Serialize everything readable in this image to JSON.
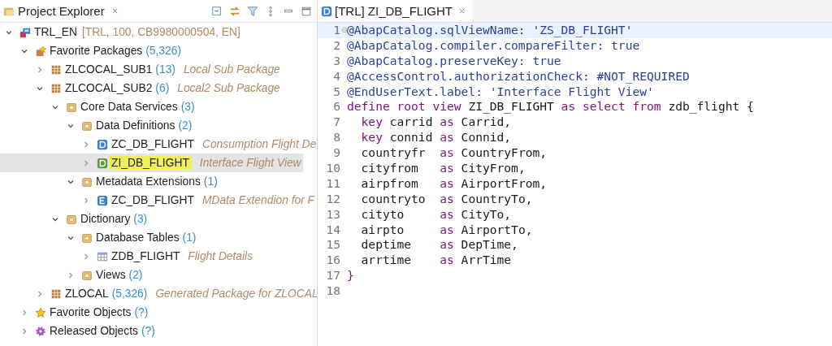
{
  "explorer": {
    "title": "Project Explorer",
    "tree": [
      {
        "name": "TRL_EN",
        "kind": "system",
        "info": "[TRL, 100, CB9980000504, EN]",
        "expanded": true,
        "selected": false,
        "children": [
          {
            "name": "Favorite Packages",
            "kind": "favorites",
            "count": "(5,326)",
            "expanded": true,
            "selected": false,
            "children": [
              {
                "name": "ZLCOCAL_SUB1",
                "kind": "package",
                "count": "(13)",
                "description": "Local Sub Package",
                "expanded": false,
                "selected": false
              },
              {
                "name": "ZLCOCAL_SUB2",
                "kind": "package",
                "count": "(6)",
                "description": "Local2 Sub Package",
                "expanded": true,
                "selected": false,
                "children": [
                  {
                    "name": "Core Data Services",
                    "kind": "folder",
                    "count": "(3)",
                    "expanded": true,
                    "selected": false,
                    "children": [
                      {
                        "name": "Data Definitions",
                        "kind": "folder",
                        "count": "(2)",
                        "expanded": true,
                        "selected": false,
                        "children": [
                          {
                            "name": "ZC_DB_FLIGHT",
                            "kind": "ddl",
                            "description": "Consumption Flight De",
                            "expanded": false,
                            "selected": false
                          },
                          {
                            "name": "ZI_DB_FLIGHT",
                            "kind": "ddl",
                            "description": "Interface Flight View",
                            "expanded": false,
                            "selected": true
                          }
                        ]
                      },
                      {
                        "name": "Metadata Extensions",
                        "kind": "folder",
                        "count": "(1)",
                        "expanded": true,
                        "selected": false,
                        "children": [
                          {
                            "name": "ZC_DB_FLIGHT",
                            "kind": "ddlx",
                            "description": "MData Extendion for F",
                            "expanded": false,
                            "selected": false
                          }
                        ]
                      }
                    ]
                  },
                  {
                    "name": "Dictionary",
                    "kind": "folder",
                    "count": "(3)",
                    "expanded": true,
                    "selected": false,
                    "children": [
                      {
                        "name": "Database Tables",
                        "kind": "folder",
                        "count": "(1)",
                        "expanded": true,
                        "selected": false,
                        "children": [
                          {
                            "name": "ZDB_FLIGHT",
                            "kind": "table",
                            "description": "Flight Details",
                            "expanded": false,
                            "selected": false
                          }
                        ]
                      },
                      {
                        "name": "Views",
                        "kind": "folder",
                        "count": "(2)",
                        "expanded": false,
                        "selected": false
                      }
                    ]
                  }
                ]
              },
              {
                "name": "ZLOCAL",
                "kind": "package",
                "count": "(5,326)",
                "description": "Generated Package for ZLOCAL",
                "expanded": false,
                "selected": false
              }
            ]
          },
          {
            "name": "Favorite Objects",
            "kind": "star",
            "count": "(?)",
            "expanded": false,
            "selected": false
          },
          {
            "name": "Released Objects",
            "kind": "gear",
            "count": "(?)",
            "expanded": false,
            "selected": false
          }
        ]
      }
    ]
  },
  "editor": {
    "tab": "[TRL] ZI_DB_FLIGHT",
    "lines": [
      {
        "n": "1",
        "current": true,
        "fold": true,
        "tokens": [
          {
            "kind": "ann",
            "text": "@AbapCatalog.sqlViewName: 'ZS_DB_FLIGHT'"
          }
        ]
      },
      {
        "n": "2",
        "current": false,
        "fold": false,
        "tokens": [
          {
            "kind": "ann",
            "text": "@AbapCatalog.compiler.compareFilter: true"
          }
        ]
      },
      {
        "n": "3",
        "current": false,
        "fold": false,
        "tokens": [
          {
            "kind": "ann",
            "text": "@AbapCatalog.preserveKey: true"
          }
        ]
      },
      {
        "n": "4",
        "current": false,
        "fold": false,
        "tokens": [
          {
            "kind": "ann",
            "text": "@AccessControl.authorizationCheck: #NOT_REQUIRED"
          }
        ]
      },
      {
        "n": "5",
        "current": false,
        "fold": false,
        "tokens": [
          {
            "kind": "ann",
            "text": "@EndUserText.label: 'Interface Flight View'"
          }
        ]
      },
      {
        "n": "6",
        "current": false,
        "fold": false,
        "tokens": [
          {
            "kind": "kw",
            "text": "define root view "
          },
          {
            "kind": "plain",
            "text": "ZI_DB_FLIGHT "
          },
          {
            "kind": "kw",
            "text": "as select from "
          },
          {
            "kind": "plain",
            "text": "zdb_flight {"
          }
        ]
      },
      {
        "n": "7",
        "current": false,
        "fold": false,
        "tokens": [
          {
            "kind": "kw",
            "text": "  key "
          },
          {
            "kind": "plain",
            "text": "carrid "
          },
          {
            "kind": "kw",
            "text": "as "
          },
          {
            "kind": "plain",
            "text": "Carrid,"
          }
        ]
      },
      {
        "n": "8",
        "current": false,
        "fold": false,
        "tokens": [
          {
            "kind": "kw",
            "text": "  key "
          },
          {
            "kind": "plain",
            "text": "connid "
          },
          {
            "kind": "kw",
            "text": "as "
          },
          {
            "kind": "plain",
            "text": "Connid,"
          }
        ]
      },
      {
        "n": "9",
        "current": false,
        "fold": false,
        "tokens": [
          {
            "kind": "plain",
            "text": "  countryfr  "
          },
          {
            "kind": "kw",
            "text": "as "
          },
          {
            "kind": "plain",
            "text": "CountryFrom,"
          }
        ]
      },
      {
        "n": "10",
        "current": false,
        "fold": false,
        "tokens": [
          {
            "kind": "plain",
            "text": "  cityfrom   "
          },
          {
            "kind": "kw",
            "text": "as "
          },
          {
            "kind": "plain",
            "text": "CityFrom,"
          }
        ]
      },
      {
        "n": "11",
        "current": false,
        "fold": false,
        "tokens": [
          {
            "kind": "plain",
            "text": "  airpfrom   "
          },
          {
            "kind": "kw",
            "text": "as "
          },
          {
            "kind": "plain",
            "text": "AirportFrom,"
          }
        ]
      },
      {
        "n": "12",
        "current": false,
        "fold": false,
        "tokens": [
          {
            "kind": "plain",
            "text": "  countryto  "
          },
          {
            "kind": "kw",
            "text": "as "
          },
          {
            "kind": "plain",
            "text": "CountryTo,"
          }
        ]
      },
      {
        "n": "13",
        "current": false,
        "fold": false,
        "tokens": [
          {
            "kind": "plain",
            "text": "  cityto     "
          },
          {
            "kind": "kw",
            "text": "as "
          },
          {
            "kind": "plain",
            "text": "CityTo,"
          }
        ]
      },
      {
        "n": "14",
        "current": false,
        "fold": false,
        "tokens": [
          {
            "kind": "plain",
            "text": "  airpto     "
          },
          {
            "kind": "kw",
            "text": "as "
          },
          {
            "kind": "plain",
            "text": "AirportTo,"
          }
        ]
      },
      {
        "n": "15",
        "current": false,
        "fold": false,
        "tokens": [
          {
            "kind": "plain",
            "text": "  deptime    "
          },
          {
            "kind": "kw",
            "text": "as "
          },
          {
            "kind": "plain",
            "text": "DepTime,"
          }
        ]
      },
      {
        "n": "16",
        "current": false,
        "fold": false,
        "tokens": [
          {
            "kind": "plain",
            "text": "  arrtime    "
          },
          {
            "kind": "kw",
            "text": "as "
          },
          {
            "kind": "plain",
            "text": "ArrTime"
          }
        ]
      },
      {
        "n": "17",
        "current": false,
        "fold": false,
        "tokens": [
          {
            "kind": "kw",
            "text": "}"
          }
        ]
      },
      {
        "n": "18",
        "current": false,
        "fold": false
      }
    ]
  }
}
